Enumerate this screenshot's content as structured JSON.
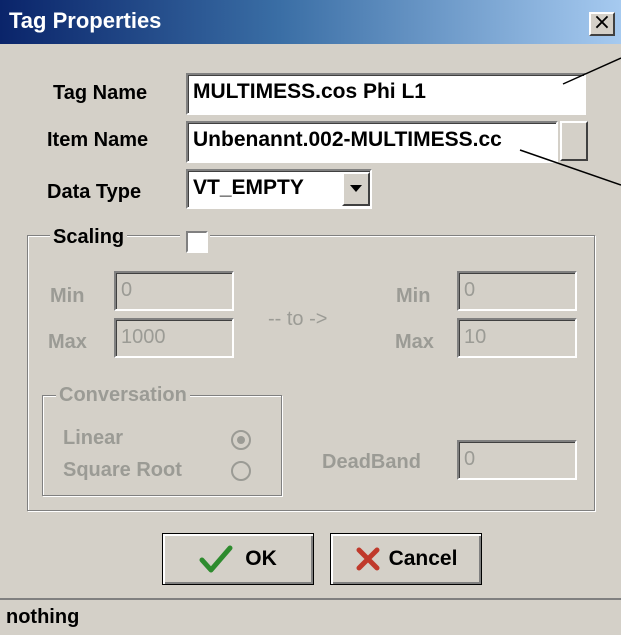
{
  "window": {
    "title": "Tag Properties",
    "close_glyph": "×"
  },
  "form": {
    "tag_name_label": "Tag Name",
    "tag_name_value": "MULTIMESS.cos Phi L1",
    "item_name_label": "Item Name",
    "item_name_value": "Unbenannt.002-MULTIMESS.cc",
    "data_type_label": "Data Type",
    "data_type_value": "VT_EMPTY"
  },
  "scaling": {
    "label": "Scaling",
    "checked": false,
    "min_label_left": "Min",
    "min_value_left": "0",
    "max_label_left": "Max",
    "max_value_left": "1000",
    "to_text": "-- to ->",
    "min_label_right": "Min",
    "min_value_right": "0",
    "max_label_right": "Max",
    "max_value_right": "10",
    "conversation_label": "Conversation",
    "linear_label": "Linear",
    "square_root_label": "Square Root",
    "selected_conversion": "Linear",
    "deadband_label": "DeadBand",
    "deadband_value": "0"
  },
  "buttons": {
    "ok_label": "OK",
    "cancel_label": "Cancel"
  },
  "status": {
    "text": "nothing"
  },
  "colors": {
    "dialog_bg": "#d4d0c8",
    "title_start": "#0a246a",
    "title_end": "#a6caf0",
    "disabled_text": "#9b9b95",
    "ok_check": "#2e8b2e",
    "cancel_x": "#c0392b"
  }
}
